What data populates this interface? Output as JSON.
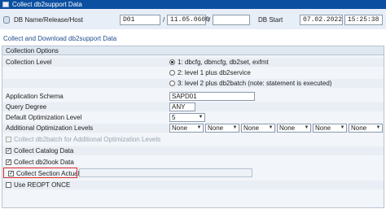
{
  "window": {
    "title": "Collect db2support Data"
  },
  "header": {
    "db_label": "DB Name/Release/Host",
    "db_name": "D01",
    "release": "11.05.0600",
    "host": "",
    "separator": "/",
    "db_start_label": "DB Start",
    "db_start_date": "07.02.2022",
    "db_start_time": "15:25:38"
  },
  "section_title": "Collect and Download db2support Data",
  "group": {
    "title": "Collection Options",
    "collection_level": {
      "label": "Collection Level",
      "options": [
        {
          "label": "1: dbcfg, dbmcfg, db2set, exfmt",
          "selected": true
        },
        {
          "label": "2: level 1 plus db2service",
          "selected": false
        },
        {
          "label": "3: level 2 plus db2batch (note: statement is executed)",
          "selected": false
        }
      ]
    },
    "application_schema": {
      "label": "Application Schema",
      "value": "SAPD01"
    },
    "query_degree": {
      "label": "Query Degree",
      "value": "ANY"
    },
    "default_opt_level": {
      "label": "Default Optimization Level",
      "value": "5"
    },
    "additional_opt_levels": {
      "label": "Additional Optimization Levels",
      "values": [
        "None",
        "None",
        "None",
        "None",
        "None",
        "None",
        "None"
      ]
    },
    "checkboxes": [
      {
        "label": "Collect db2batch for Additional Optimization Levels",
        "checked": false,
        "enabled": false
      },
      {
        "label": "Collect Catalog Data",
        "checked": true,
        "enabled": true
      },
      {
        "label": "Collect db2look Data",
        "checked": true,
        "enabled": true
      },
      {
        "label": "Collect Section Actuals",
        "checked": true,
        "enabled": true
      },
      {
        "label": "Use REOPT ONCE",
        "checked": false,
        "enabled": true
      }
    ],
    "check_mark": "✓"
  },
  "colors": {
    "titlebar": "#0b4fa0",
    "highlight": "#d9262c",
    "section_title": "#1e4e8c"
  }
}
